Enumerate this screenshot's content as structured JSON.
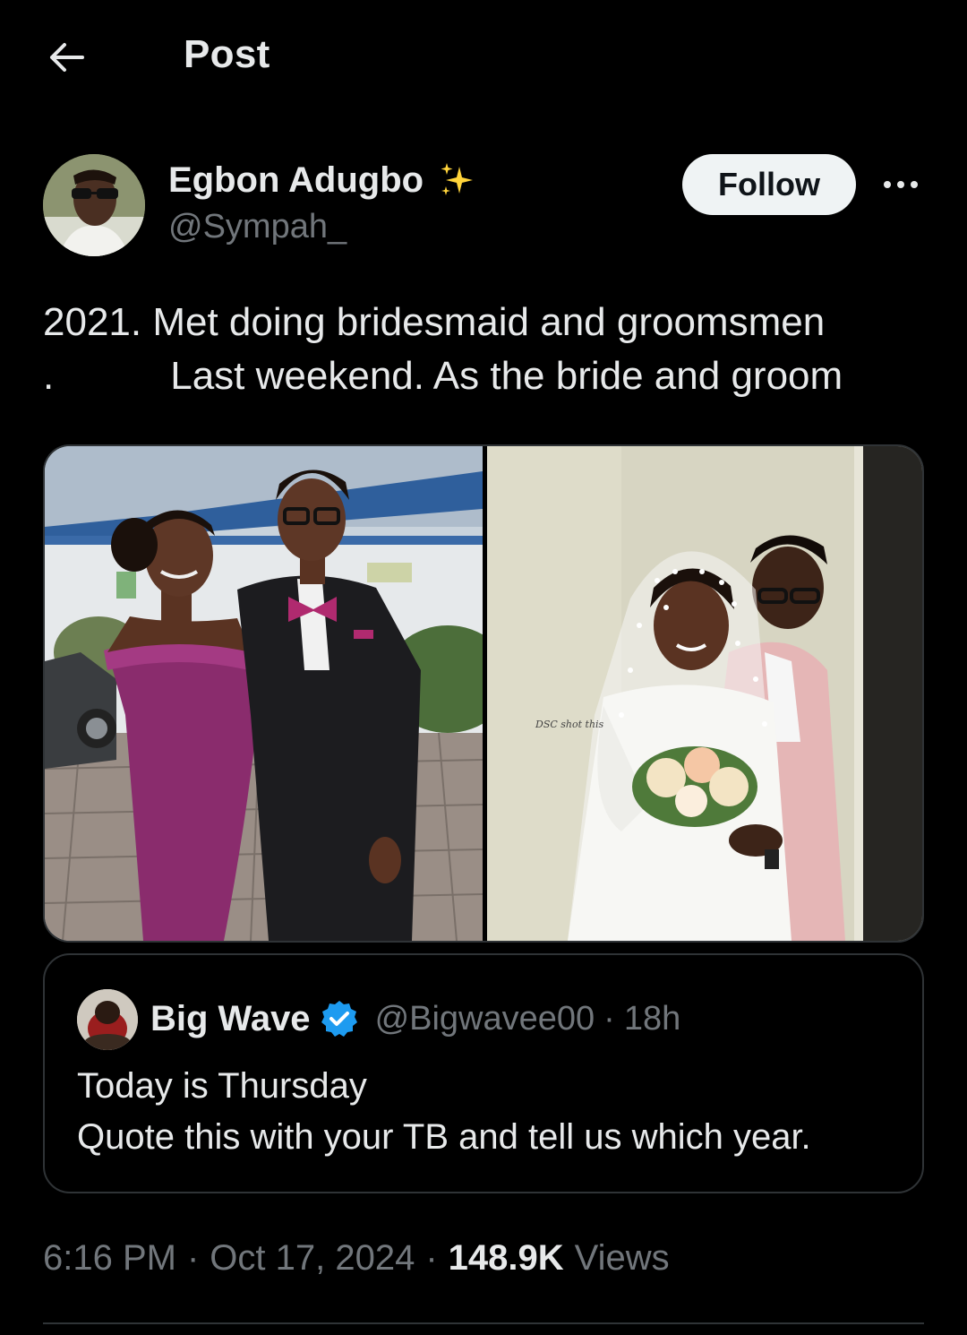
{
  "header": {
    "title": "Post",
    "back_icon": "arrow-left-icon"
  },
  "author": {
    "name": "Egbon Adugbo",
    "name_emoji": "sparkles-icon",
    "handle": "@Sympah_",
    "follow_label": "Follow",
    "more_icon": "more-horizontal-icon"
  },
  "tweet": {
    "lines": [
      "2021. Met doing bridesmaid and groomsmen",
      ".",
      "Last weekend. As the bride and groom"
    ]
  },
  "media": {
    "left_photo_watermark": "",
    "right_photo_watermark": "DSC shot this"
  },
  "quote": {
    "name": "Big Wave",
    "verified_icon": "verified-badge-icon",
    "handle": "@Bigwavee00",
    "separator": "·",
    "time": "18h",
    "lines": [
      "Today is Thursday",
      "Quote this with your TB and tell us which year."
    ]
  },
  "meta": {
    "time": "6:16 PM",
    "separator": "·",
    "date": "Oct 17, 2024",
    "views_count": "148.9K",
    "views_label": "Views"
  },
  "colors": {
    "background": "#000000",
    "text_primary": "#e7e9ea",
    "text_secondary": "#71767b",
    "border": "#2f3336",
    "follow_bg": "#eff3f4",
    "verified_blue": "#1d9bf0"
  }
}
